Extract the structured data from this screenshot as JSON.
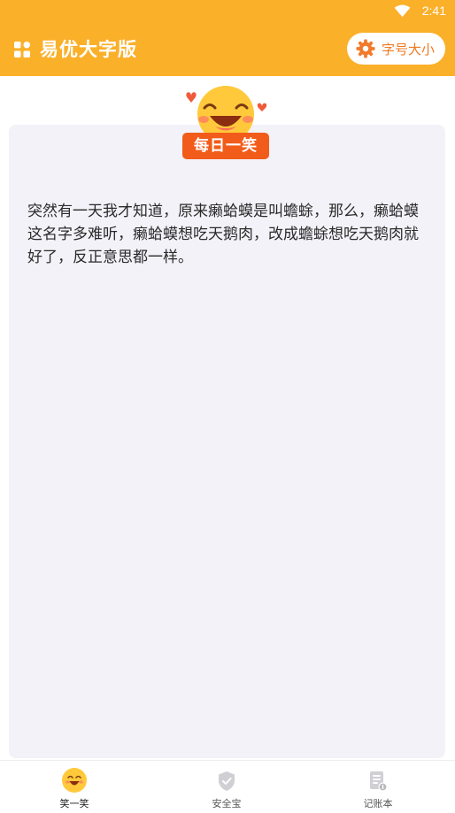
{
  "status_bar": {
    "time": "2:41"
  },
  "app_bar": {
    "title": "易优大字版",
    "font_size_button": "字号大小"
  },
  "card": {
    "badge": "每日一笑",
    "joke": "突然有一天我才知道，原来癞蛤蟆是叫蟾蜍，那么，癞蛤蟆这名字多难听，癞蛤蟆想吃天鹅肉，改成蟾蜍想吃天鹅肉就好了，反正意思都一样。"
  },
  "tabs": [
    {
      "label": "笑一笑",
      "icon": "smile-icon",
      "active": true
    },
    {
      "label": "安全宝",
      "icon": "shield-icon",
      "active": false
    },
    {
      "label": "记账本",
      "icon": "ledger-icon",
      "active": false
    }
  ],
  "colors": {
    "brand": "#fbb02a",
    "accent": "#f25c1b",
    "card_bg": "#f3f2f8"
  }
}
